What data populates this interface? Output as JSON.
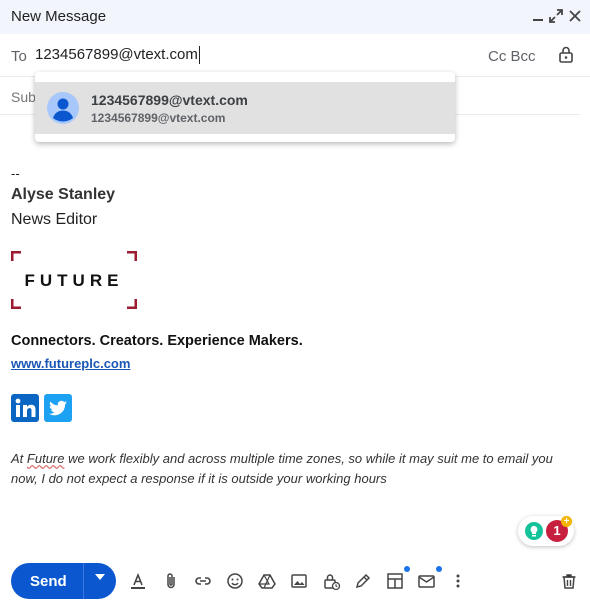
{
  "window": {
    "title": "New Message"
  },
  "recipients": {
    "to_label": "To",
    "to_value": "1234567899@vtext.com",
    "cc_bcc_label": "Cc Bcc",
    "subject_placeholder": "Sub"
  },
  "suggestion": {
    "name": "1234567899@vtext.com",
    "email": "1234567899@vtext.com"
  },
  "signature": {
    "separator": "--",
    "name": "Alyse Stanley",
    "title": "News Editor",
    "logo_text": "FUTURE",
    "tagline": "Connectors. Creators. Experience Makers.",
    "website": "www.futureplc.com",
    "social": [
      "linkedin-icon",
      "twitter-icon"
    ],
    "note_prefix": "At ",
    "note_word": "Future",
    "note_rest": " we work flexibly and across multiple time zones, so while it may suit me to email you now, I do not expect a response if it is outside your working hours"
  },
  "grammar_badge": {
    "count": "1"
  },
  "toolbar": {
    "send_label": "Send",
    "icons": [
      "format-text-icon",
      "attach-icon",
      "link-icon",
      "emoji-icon",
      "drive-icon",
      "photo-icon",
      "confidential-icon",
      "signature-icon",
      "layouts-icon",
      "layouts-templates-icon",
      "more-options-icon",
      "discard-icon"
    ]
  },
  "colors": {
    "accent": "#0b57d0",
    "logo_red": "#9b1b30",
    "titlebar": "#f2f6fc"
  }
}
